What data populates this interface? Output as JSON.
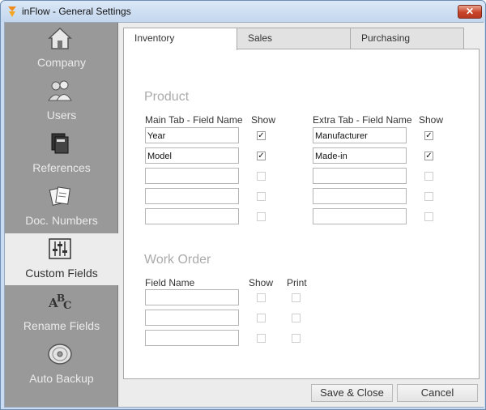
{
  "window": {
    "title": "inFlow - General Settings",
    "close_glyph": "✕"
  },
  "sidebar": {
    "items": [
      {
        "label": "Company",
        "icon": "house-icon"
      },
      {
        "label": "Users",
        "icon": "users-icon"
      },
      {
        "label": "References",
        "icon": "books-icon"
      },
      {
        "label": "Doc. Numbers",
        "icon": "documents-icon"
      },
      {
        "label": "Custom Fields",
        "icon": "sliders-icon",
        "active": true
      },
      {
        "label": "Rename Fields",
        "icon": "abc-icon"
      },
      {
        "label": "Auto Backup",
        "icon": "disc-icon"
      }
    ]
  },
  "tabs": [
    {
      "label": "Inventory",
      "active": true
    },
    {
      "label": "Sales"
    },
    {
      "label": "Purchasing"
    }
  ],
  "product": {
    "title": "Product",
    "main_header": "Main Tab - Field Name",
    "extra_header": "Extra Tab - Field Name",
    "show_header": "Show",
    "main_fields": [
      {
        "value": "Year",
        "show": true
      },
      {
        "value": "Model",
        "show": true
      },
      {
        "value": "",
        "show": false
      },
      {
        "value": "",
        "show": false
      },
      {
        "value": "",
        "show": false
      }
    ],
    "extra_fields": [
      {
        "value": "Manufacturer",
        "show": true
      },
      {
        "value": "Made-in",
        "show": true
      },
      {
        "value": "",
        "show": false
      },
      {
        "value": "",
        "show": false
      },
      {
        "value": "",
        "show": false
      }
    ]
  },
  "work_order": {
    "title": "Work Order",
    "field_header": "Field Name",
    "show_header": "Show",
    "print_header": "Print",
    "fields": [
      {
        "value": "",
        "show": false,
        "print": false
      },
      {
        "value": "",
        "show": false,
        "print": false
      },
      {
        "value": "",
        "show": false,
        "print": false
      }
    ]
  },
  "buttons": {
    "save_close": "Save & Close",
    "cancel": "Cancel"
  }
}
